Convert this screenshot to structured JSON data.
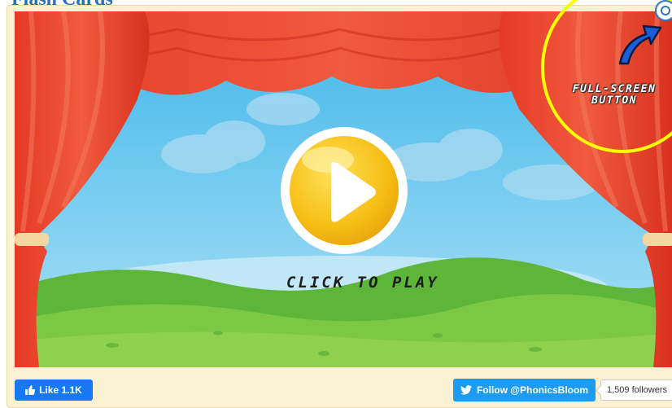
{
  "header": {
    "title": "Flash Cards"
  },
  "game": {
    "play_label": "CLICK TO PLAY",
    "fullscreen_annotation": "FULL-SCREEN\nBUTTON"
  },
  "social": {
    "like_label": "Like 1.1K",
    "follow_label": "Follow @PhonicsBloom",
    "followers_count": "1,509 followers"
  },
  "colors": {
    "curtain": "#e8402b",
    "sky": "#5ec2ec",
    "play_button": "#f7c21a",
    "annotation": "#ffff00",
    "facebook": "#1877f2",
    "twitter": "#1d9bf0"
  }
}
